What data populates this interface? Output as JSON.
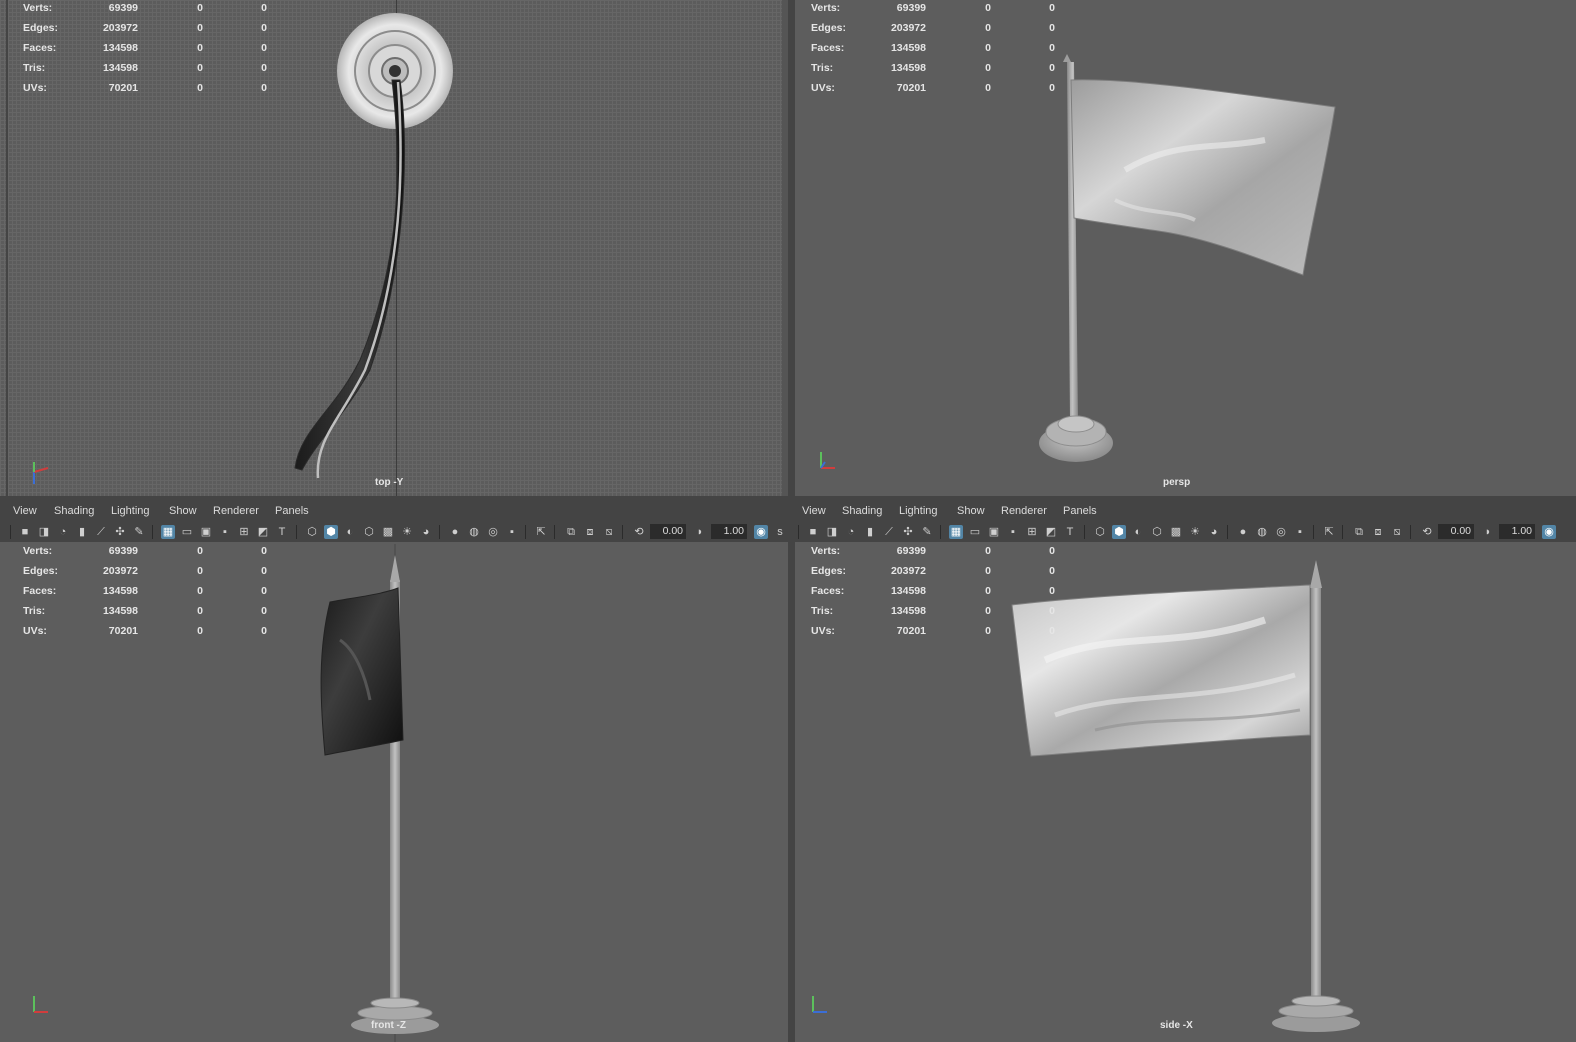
{
  "colors": {
    "panel_bg": "#444444",
    "viewport_bg": "#5d5d5d",
    "active_icon": "#5285a6",
    "field_bg": "#2b2b2b"
  },
  "stats": {
    "rows": [
      {
        "label": "Verts:",
        "total": "69399",
        "selected": "0",
        "component": "0"
      },
      {
        "label": "Edges:",
        "total": "203972",
        "selected": "0",
        "component": "0"
      },
      {
        "label": "Faces:",
        "total": "134598",
        "selected": "0",
        "component": "0"
      },
      {
        "label": "Tris:",
        "total": "134598",
        "selected": "0",
        "component": "0"
      },
      {
        "label": "UVs:",
        "total": "70201",
        "selected": "0",
        "component": "0"
      }
    ]
  },
  "viewports": {
    "top": {
      "camera": "top -Y"
    },
    "persp": {
      "camera": "persp"
    },
    "front": {
      "camera": "front -Z"
    },
    "side": {
      "camera": "side -X"
    }
  },
  "menu": {
    "view": "View",
    "shading": "Shading",
    "lighting": "Lighting",
    "show": "Show",
    "renderer": "Renderer",
    "panels": "Panels"
  },
  "toolbar": {
    "exposure": "0.00",
    "gamma": "1.00"
  },
  "icons": [
    "camera-select-icon",
    "camera-attributes-icon",
    "bookmark-icon",
    "image-plane-icon",
    "grid-icon",
    "film-gate-icon",
    "resolution-gate-icon",
    "gate-mask-icon",
    "field-chart-icon",
    "safe-action-icon",
    "safe-title-icon",
    "wireframe-icon",
    "smooth-shade-icon",
    "wireframe-on-shaded-icon",
    "default-material-icon",
    "textured-icon",
    "lights-icon",
    "shadows-icon",
    "screen-space-ao-icon",
    "motion-blur-icon",
    "anti-aliasing-icon",
    "isolate-select-icon",
    "xray-icon",
    "xray-joints-icon",
    "backface-culling-icon",
    "exposure-icon",
    "gamma-icon",
    "color-management-icon"
  ]
}
